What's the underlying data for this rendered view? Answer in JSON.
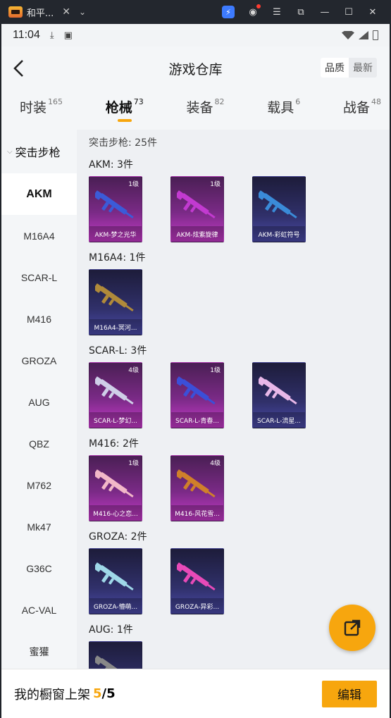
{
  "chrome": {
    "tab_title": "和平...",
    "close_glyph": "✕",
    "more_glyph": "⌄"
  },
  "status": {
    "time": "11:04"
  },
  "header": {
    "title": "游戏仓库",
    "sort_quality": "品质",
    "sort_latest": "最新"
  },
  "tabs": [
    {
      "label": "时装",
      "count": "165"
    },
    {
      "label": "枪械",
      "count": "73"
    },
    {
      "label": "装备",
      "count": "82"
    },
    {
      "label": "载具",
      "count": "6"
    },
    {
      "label": "战备",
      "count": "48"
    }
  ],
  "sidebar": {
    "category": "突击步枪",
    "items": [
      "AKM",
      "M16A4",
      "SCAR-L",
      "M416",
      "GROZA",
      "AUG",
      "QBZ",
      "M762",
      "Mk47",
      "G36C",
      "AC-VAL",
      "蜜獾"
    ]
  },
  "main": {
    "summary": "突击步枪: 25件",
    "groups": [
      {
        "title": "AKM: 3件",
        "cards": [
          {
            "name": "AKM-梦之光华",
            "level": "1级",
            "style": "pink",
            "gun_color": "#3b5bd8"
          },
          {
            "name": "AKM-炫紫旋律",
            "level": "1级",
            "style": "pink",
            "gun_color": "#c23ad0"
          },
          {
            "name": "AKM-彩虹符号",
            "level": "",
            "style": "purple",
            "gun_color": "#3a8bd8"
          }
        ]
      },
      {
        "title": "M16A4: 1件",
        "cards": [
          {
            "name": "M16A4-冥河...",
            "level": "",
            "style": "purple",
            "gun_color": "#b08a3a"
          }
        ]
      },
      {
        "title": "SCAR-L: 3件",
        "cards": [
          {
            "name": "SCAR-L-梦幻...",
            "level": "4级",
            "style": "pink",
            "gun_color": "#cfcfe8"
          },
          {
            "name": "SCAR-L-青春...",
            "level": "1级",
            "style": "pink",
            "gun_color": "#3b4fd8"
          },
          {
            "name": "SCAR-L-流星...",
            "level": "",
            "style": "purple",
            "gun_color": "#e8b8e8"
          }
        ]
      },
      {
        "title": "M416: 2件",
        "cards": [
          {
            "name": "M416-心之恋...",
            "level": "1级",
            "style": "pink",
            "gun_color": "#f2b8c8"
          },
          {
            "name": "M416-风花雪...",
            "level": "4级",
            "style": "pink",
            "gun_color": "#d0802a"
          }
        ]
      },
      {
        "title": "GROZA: 2件",
        "cards": [
          {
            "name": "GROZA-懵萌...",
            "level": "",
            "style": "purple",
            "gun_color": "#9fd8e8"
          },
          {
            "name": "GROZA-异彩...",
            "level": "",
            "style": "purple",
            "gun_color": "#e84ab8"
          }
        ]
      },
      {
        "title": "AUG: 1件",
        "cards": [
          {
            "name": "",
            "level": "",
            "style": "purple",
            "gun_color": "#888888"
          }
        ]
      }
    ]
  },
  "footer": {
    "label": "我的橱窗上架",
    "current": "5",
    "separator": "/",
    "total": "5",
    "edit": "编辑"
  },
  "colors": {
    "accent": "#f7a60e"
  }
}
